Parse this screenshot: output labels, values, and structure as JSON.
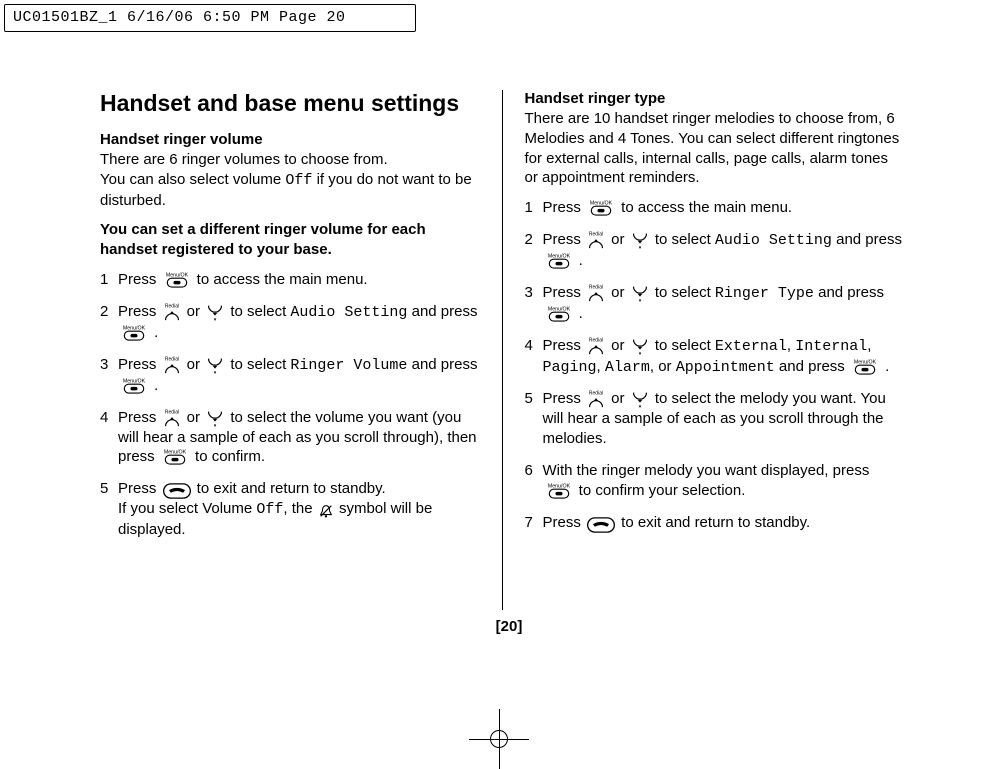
{
  "header_slug": "UC01501BZ_1  6/16/06  6:50 PM  Page 20",
  "page_number": "[20]",
  "left": {
    "title": "Handset and base menu settings",
    "sec1_h": "Handset ringer volume",
    "sec1_p1": "There are 6 ringer volumes to choose from.",
    "sec1_p2a": "You can also select volume ",
    "sec1_p2_mono": "Off",
    "sec1_p2b": " if you do not want to be disturbed.",
    "sec1_bold": "You can set a different ringer volume for each handset registered to your base.",
    "s1": {
      "n": "1",
      "a": "Press ",
      "b": " to access the main menu."
    },
    "s2": {
      "n": "2",
      "a": "Press ",
      "b": " or ",
      "c": " to select ",
      "mono": "Audio Setting",
      "d": " and press ",
      "e": " ."
    },
    "s3": {
      "n": "3",
      "a": "Press ",
      "b": " or ",
      "c": " to select ",
      "mono": "Ringer Volume",
      "d": " and press ",
      "e": " ."
    },
    "s4": {
      "n": "4",
      "a": "Press ",
      "b": " or ",
      "c": " to select the volume you want (you will hear a sample of each as you scroll through), then press ",
      "d": " to confirm."
    },
    "s5": {
      "n": "5",
      "a": "Press ",
      "b": " to exit and return to standby.",
      "c": "If you select Volume ",
      "mono": "Off",
      "d": ", the ",
      "e": " symbol will be displayed."
    }
  },
  "right": {
    "sec_h": "Handset ringer type",
    "sec_p": "There are 10 handset ringer melodies to choose from, 6 Melodies and 4 Tones. You can select different ringtones for external calls, internal calls, page calls, alarm tones or appointment reminders.",
    "s1": {
      "n": "1",
      "a": "Press ",
      "b": " to access the main menu."
    },
    "s2": {
      "n": "2",
      "a": "Press ",
      "b": " or ",
      "c": " to select ",
      "mono": "Audio Setting",
      "d": " and press ",
      "e": " ."
    },
    "s3": {
      "n": "3",
      "a": "Press ",
      "b": " or ",
      "c": " to select ",
      "mono": "Ringer Type",
      "d": " and press ",
      "e": " ."
    },
    "s4": {
      "n": "4",
      "a": "Press ",
      "b": " or ",
      "c": " to select ",
      "m1": "External",
      "comma1": ", ",
      "m2": "Internal",
      "comma2": ", ",
      "m3": "Paging",
      "comma3": ", ",
      "m4": "Alarm",
      "comma4": ", or ",
      "m5": "Appointment",
      "d": " and press ",
      "e": " ."
    },
    "s5": {
      "n": "5",
      "a": "Press ",
      "b": " or ",
      "c": " to select the melody you want. You will hear a sample of each as you scroll through the melodies."
    },
    "s6": {
      "n": "6",
      "a": "With the ringer melody you want displayed, press ",
      "b": " to confirm your selection."
    },
    "s7": {
      "n": "7",
      "a": "Press ",
      "b": " to exit and return to standby."
    }
  }
}
